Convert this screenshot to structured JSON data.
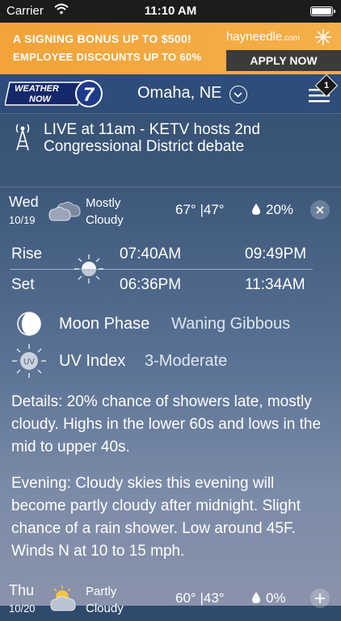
{
  "status_bar": {
    "carrier": "Carrier",
    "time": "11:10 AM"
  },
  "ad": {
    "line1": "A SIGNING BONUS UP TO $500!",
    "line2": "EMPLOYEE DISCOUNTS UP TO 60%",
    "brand": "hayneedle",
    "brand_suffix": ".com",
    "cta": "APPLY NOW"
  },
  "header": {
    "logo_text": "WEATHER NOW",
    "logo_number": "7",
    "location": "Omaha, NE",
    "menu_badge": "1"
  },
  "alert": {
    "text": "LIVE at 11am - KETV hosts 2nd Congressional District debate"
  },
  "days": [
    {
      "name": "Wed",
      "date": "10/19",
      "condition": "Mostly Cloudy",
      "high": "67°",
      "low": "47°",
      "sep": "|",
      "precip": "20%",
      "control": "×"
    },
    {
      "name": "Thu",
      "date": "10/20",
      "condition": "Partly Cloudy",
      "high": "60°",
      "low": "43°",
      "sep": "|",
      "precip": "0%",
      "control": "+"
    }
  ],
  "astro": {
    "rise_label": "Rise",
    "set_label": "Set",
    "sunrise": "07:40AM",
    "sunset": "06:36PM",
    "moonrise": "09:49PM",
    "moonset": "11:34AM"
  },
  "moon_phase": {
    "label": "Moon Phase",
    "value": "Waning Gibbous"
  },
  "uv_index": {
    "label": "UV Index",
    "value": "3-Moderate",
    "icon_text": "UV"
  },
  "details": "Details: 20% chance of showers late, mostly cloudy. Highs in the lower 60s and lows in the mid to upper 40s.",
  "evening": "Evening: Cloudy skies this evening will become partly cloudy after midnight. Slight chance of a rain shower. Low around 45F. Winds N at 10 to 15 mph."
}
